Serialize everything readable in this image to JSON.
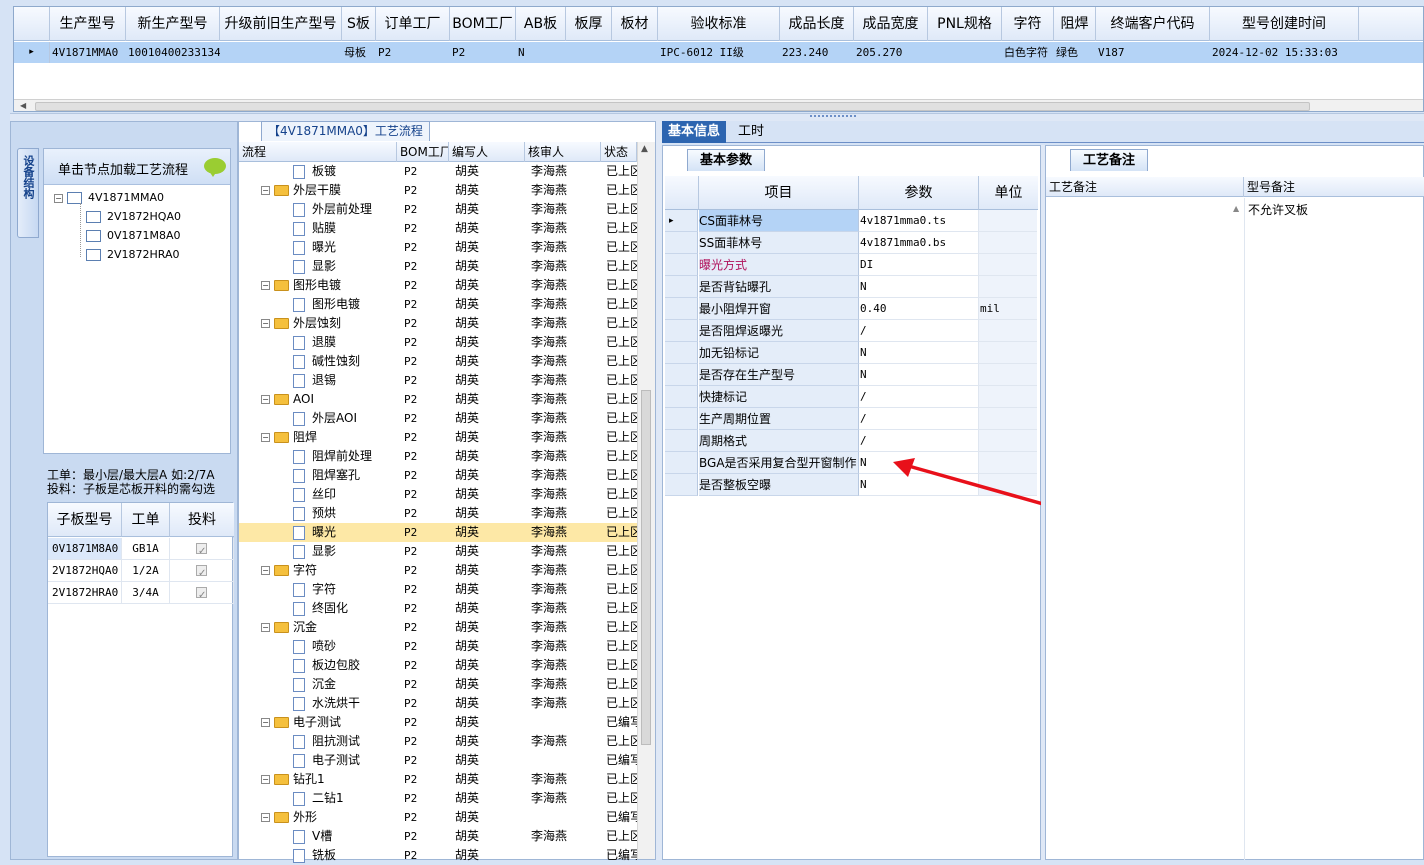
{
  "top_grid": {
    "headers": [
      "生产型号",
      "新生产型号",
      "升级前旧生产型号",
      "S板",
      "订单工厂",
      "BOM工厂",
      "AB板",
      "板厚",
      "板材",
      "验收标准",
      "成品长度",
      "成品宽度",
      "PNL规格",
      "字符",
      "阻焊",
      "终端客户代码",
      "型号创建时间"
    ],
    "row": {
      "arrow": "▸",
      "values": [
        "4V1871MMA0",
        "10010400233134",
        "",
        "母板",
        "P2",
        "P2",
        "N",
        "",
        "",
        "IPC-6012 II级",
        "223.240",
        "205.270",
        "",
        "白色字符",
        "绿色",
        "V187",
        "2024-12-02 15:33:03"
      ]
    }
  },
  "left": {
    "vertical_tab": "设备结构",
    "tree_header": "单击节点加载工艺流程",
    "tree": [
      "4V1871MMA0",
      "2V1872HQA0",
      "0V1871M8A0",
      "2V1872HRA0"
    ],
    "hint_line1": "工单：最小层/最大层A 如:2/7A",
    "hint_line2": "投料：子板是芯板开料的需勾选",
    "table_headers": [
      "子板型号",
      "工单",
      "投料"
    ],
    "rows": [
      {
        "model": "0V1871M8A0",
        "order": "GB1A",
        "feed": true
      },
      {
        "model": "2V1872HQA0",
        "order": "1/2A",
        "feed": true
      },
      {
        "model": "2V1872HRA0",
        "order": "3/4A",
        "feed": true
      }
    ]
  },
  "middle": {
    "tab_label": "【4V1871MMA0】工艺流程",
    "headers": [
      "流程",
      "BOM工厂",
      "编写人",
      "核审人",
      "状态"
    ],
    "rows": [
      {
        "t": "c",
        "name": "板镀",
        "bom": "P2",
        "w": "胡英",
        "r": "李海燕",
        "s": "已上区"
      },
      {
        "t": "f",
        "name": "外层干膜",
        "bom": "P2",
        "w": "胡英",
        "r": "李海燕",
        "s": "已上区"
      },
      {
        "t": "c",
        "name": "外层前处理",
        "bom": "P2",
        "w": "胡英",
        "r": "李海燕",
        "s": "已上区"
      },
      {
        "t": "c",
        "name": "贴膜",
        "bom": "P2",
        "w": "胡英",
        "r": "李海燕",
        "s": "已上区"
      },
      {
        "t": "c",
        "name": "曝光",
        "bom": "P2",
        "w": "胡英",
        "r": "李海燕",
        "s": "已上区"
      },
      {
        "t": "c",
        "name": "显影",
        "bom": "P2",
        "w": "胡英",
        "r": "李海燕",
        "s": "已上区"
      },
      {
        "t": "f",
        "name": "图形电镀",
        "bom": "P2",
        "w": "胡英",
        "r": "李海燕",
        "s": "已上区"
      },
      {
        "t": "c",
        "name": "图形电镀",
        "bom": "P2",
        "w": "胡英",
        "r": "李海燕",
        "s": "已上区"
      },
      {
        "t": "f",
        "name": "外层蚀刻",
        "bom": "P2",
        "w": "胡英",
        "r": "李海燕",
        "s": "已上区"
      },
      {
        "t": "c",
        "name": "退膜",
        "bom": "P2",
        "w": "胡英",
        "r": "李海燕",
        "s": "已上区"
      },
      {
        "t": "c",
        "name": "碱性蚀刻",
        "bom": "P2",
        "w": "胡英",
        "r": "李海燕",
        "s": "已上区"
      },
      {
        "t": "c",
        "name": "退锡",
        "bom": "P2",
        "w": "胡英",
        "r": "李海燕",
        "s": "已上区"
      },
      {
        "t": "f",
        "name": "AOI",
        "bom": "P2",
        "w": "胡英",
        "r": "李海燕",
        "s": "已上区"
      },
      {
        "t": "c",
        "name": "外层AOI",
        "bom": "P2",
        "w": "胡英",
        "r": "李海燕",
        "s": "已上区"
      },
      {
        "t": "f",
        "name": "阻焊",
        "bom": "P2",
        "w": "胡英",
        "r": "李海燕",
        "s": "已上区"
      },
      {
        "t": "c",
        "name": "阻焊前处理",
        "bom": "P2",
        "w": "胡英",
        "r": "李海燕",
        "s": "已上区"
      },
      {
        "t": "c",
        "name": "阻焊塞孔",
        "bom": "P2",
        "w": "胡英",
        "r": "李海燕",
        "s": "已上区"
      },
      {
        "t": "c",
        "name": "丝印",
        "bom": "P2",
        "w": "胡英",
        "r": "李海燕",
        "s": "已上区"
      },
      {
        "t": "c",
        "name": "预烘",
        "bom": "P2",
        "w": "胡英",
        "r": "李海燕",
        "s": "已上区"
      },
      {
        "t": "c",
        "name": "曝光",
        "bom": "P2",
        "w": "胡英",
        "r": "李海燕",
        "s": "已上区",
        "sel": true
      },
      {
        "t": "c",
        "name": "显影",
        "bom": "P2",
        "w": "胡英",
        "r": "李海燕",
        "s": "已上区"
      },
      {
        "t": "f",
        "name": "字符",
        "bom": "P2",
        "w": "胡英",
        "r": "李海燕",
        "s": "已上区"
      },
      {
        "t": "c",
        "name": "字符",
        "bom": "P2",
        "w": "胡英",
        "r": "李海燕",
        "s": "已上区"
      },
      {
        "t": "c",
        "name": "终固化",
        "bom": "P2",
        "w": "胡英",
        "r": "李海燕",
        "s": "已上区"
      },
      {
        "t": "f",
        "name": "沉金",
        "bom": "P2",
        "w": "胡英",
        "r": "李海燕",
        "s": "已上区"
      },
      {
        "t": "c",
        "name": "喷砂",
        "bom": "P2",
        "w": "胡英",
        "r": "李海燕",
        "s": "已上区"
      },
      {
        "t": "c",
        "name": "板边包胶",
        "bom": "P2",
        "w": "胡英",
        "r": "李海燕",
        "s": "已上区"
      },
      {
        "t": "c",
        "name": "沉金",
        "bom": "P2",
        "w": "胡英",
        "r": "李海燕",
        "s": "已上区"
      },
      {
        "t": "c",
        "name": "水洗烘干",
        "bom": "P2",
        "w": "胡英",
        "r": "李海燕",
        "s": "已上区"
      },
      {
        "t": "f",
        "name": "电子测试",
        "bom": "P2",
        "w": "胡英",
        "r": "",
        "s": "已编写"
      },
      {
        "t": "c",
        "name": "阻抗测试",
        "bom": "P2",
        "w": "胡英",
        "r": "李海燕",
        "s": "已上区"
      },
      {
        "t": "c",
        "name": "电子测试",
        "bom": "P2",
        "w": "胡英",
        "r": "",
        "s": "已编写"
      },
      {
        "t": "f",
        "name": "钻孔1",
        "bom": "P2",
        "w": "胡英",
        "r": "李海燕",
        "s": "已上区"
      },
      {
        "t": "c",
        "name": "二钻1",
        "bom": "P2",
        "w": "胡英",
        "r": "李海燕",
        "s": "已上区"
      },
      {
        "t": "f",
        "name": "外形",
        "bom": "P2",
        "w": "胡英",
        "r": "",
        "s": "已编写"
      },
      {
        "t": "c",
        "name": "V槽",
        "bom": "P2",
        "w": "胡英",
        "r": "李海燕",
        "s": "已上区"
      },
      {
        "t": "c",
        "name": "铣板",
        "bom": "P2",
        "w": "胡英",
        "r": "",
        "s": "已编写"
      }
    ]
  },
  "right": {
    "tabs": [
      "基本信息",
      "工时"
    ],
    "basic_subtab": "基本参数",
    "grid_headers": [
      "项目",
      "参数",
      "单位"
    ],
    "params": [
      {
        "k": "CS面菲林号",
        "v": "4v1871mma0.ts",
        "u": "",
        "sel": true
      },
      {
        "k": "SS面菲林号",
        "v": "4v1871mma0.bs",
        "u": ""
      },
      {
        "k": "曝光方式",
        "v": "DI",
        "u": "",
        "red": true
      },
      {
        "k": "是否背钻曝孔",
        "v": "N",
        "u": ""
      },
      {
        "k": "最小阻焊开窗",
        "v": "0.40",
        "u": "mil"
      },
      {
        "k": "是否阻焊返曝光",
        "v": "/",
        "u": ""
      },
      {
        "k": "加无铅标记",
        "v": "N",
        "u": ""
      },
      {
        "k": "是否存在生产型号",
        "v": "N",
        "u": ""
      },
      {
        "k": "快捷标记",
        "v": "/",
        "u": ""
      },
      {
        "k": "生产周期位置",
        "v": "/",
        "u": ""
      },
      {
        "k": "周期格式",
        "v": "/",
        "u": ""
      },
      {
        "k": "BGA是否采用复合型开窗制作",
        "v": "N",
        "u": ""
      },
      {
        "k": "是否整板空曝",
        "v": "N",
        "u": ""
      }
    ],
    "remark_tab": "工艺备注",
    "remark_headers": [
      "工艺备注",
      "型号备注"
    ],
    "model_remark": "不允许叉板",
    "accent_color": "#2d65b0",
    "arrow_color": "#e8101a"
  }
}
